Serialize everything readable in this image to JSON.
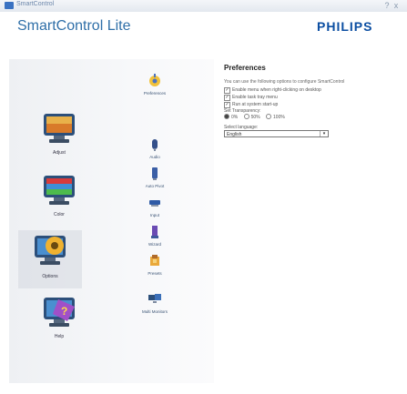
{
  "window": {
    "title": "SmartControl",
    "help": "?",
    "close": "x"
  },
  "header": {
    "app_title": "SmartControl Lite",
    "brand": "PHILIPS"
  },
  "nav": {
    "items": [
      {
        "label": "Adjust",
        "icon": "monitor-adjust-icon"
      },
      {
        "label": "Color",
        "icon": "monitor-color-icon"
      },
      {
        "label": "Options",
        "icon": "monitor-options-icon",
        "selected": true
      },
      {
        "label": "Help",
        "icon": "monitor-help-icon"
      }
    ]
  },
  "subnav": {
    "items": [
      {
        "label": "Preferences",
        "icon": "preferences-icon",
        "selected": true
      },
      {
        "label": "Audio",
        "icon": "audio-icon"
      },
      {
        "label": "Auto Pivot",
        "icon": "auto-pivot-icon"
      },
      {
        "label": "Input",
        "icon": "input-icon"
      },
      {
        "label": "Wizard",
        "icon": "wizard-icon"
      },
      {
        "label": "Presets",
        "icon": "presets-icon"
      },
      {
        "label": "Multi Monitors",
        "icon": "multi-monitors-icon"
      }
    ]
  },
  "preferences": {
    "title": "Preferences",
    "description": "You can use the following options to configure SmartControl",
    "options": [
      {
        "label": "Enable menu when right-clicking on desktop",
        "checked": true
      },
      {
        "label": "Enable task tray menu",
        "checked": true
      },
      {
        "label": "Run at system start-up",
        "checked": true
      }
    ],
    "transparency_label": "Set Transparency:",
    "transparency_options": [
      {
        "label": "0%",
        "selected": true
      },
      {
        "label": "50%",
        "selected": false
      },
      {
        "label": "100%",
        "selected": false
      }
    ],
    "language_label": "Select language:",
    "language_value": "English"
  },
  "colors": {
    "accent": "#2f6fa8",
    "brand": "#0b4ea2"
  }
}
